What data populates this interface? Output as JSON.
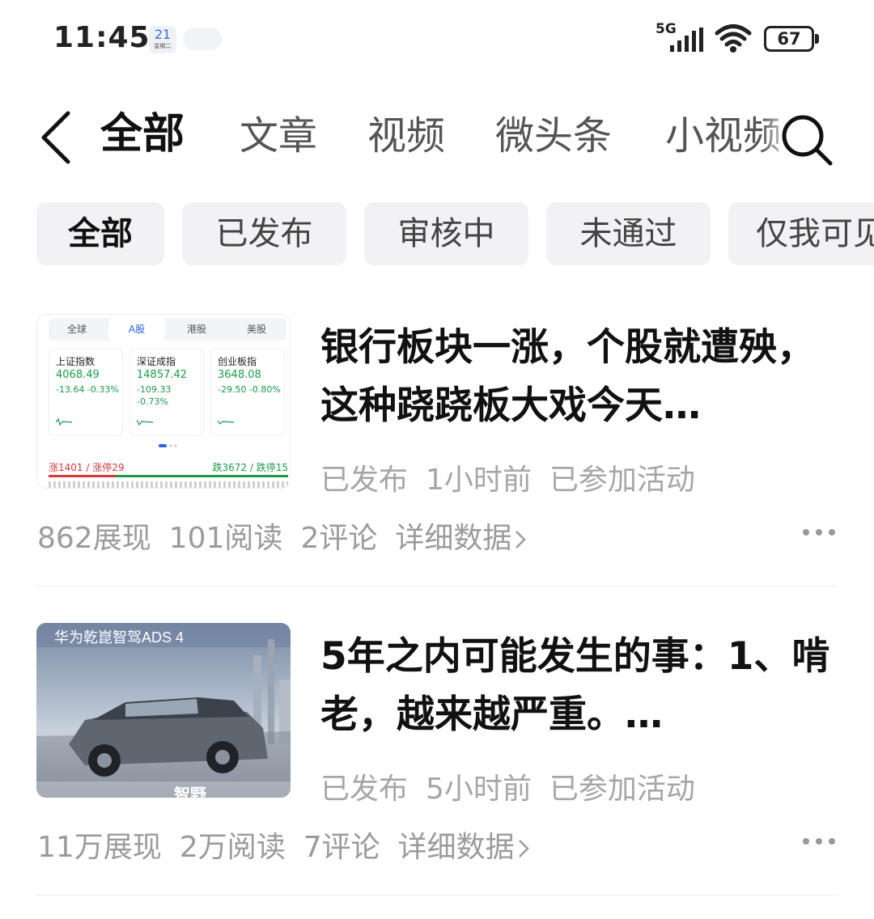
{
  "status_bar": {
    "time": "11:45",
    "calendar_day": "21",
    "calendar_sub": "星期二",
    "network": "5G",
    "battery": "67"
  },
  "header": {
    "tabs": [
      {
        "label": "全部",
        "active": true
      },
      {
        "label": "文章",
        "active": false
      },
      {
        "label": "视频",
        "active": false
      },
      {
        "label": "微头条",
        "active": false
      },
      {
        "label": "小视频",
        "active": false
      }
    ]
  },
  "filters": [
    {
      "label": "全部",
      "active": true
    },
    {
      "label": "已发布",
      "active": false
    },
    {
      "label": "审核中",
      "active": false
    },
    {
      "label": "未通过",
      "active": false
    },
    {
      "label": "仅我可见",
      "active": false
    }
  ],
  "feed": [
    {
      "title": "银行板块一涨，个股就遭殃，这种跷跷板大戏今天…",
      "meta": [
        "已发布",
        "1小时前",
        "已参加活动"
      ],
      "stats": [
        "862展现",
        "101阅读",
        "2评论"
      ],
      "detail_label": "详细数据",
      "thumbnail": {
        "tabs": [
          "全球",
          "A股",
          "港股",
          "美股"
        ],
        "selected_tab": "A股",
        "indices": [
          {
            "name": "上证指数",
            "value": "4068.49",
            "change": "-13.64 -0.33%"
          },
          {
            "name": "深证成指",
            "value": "14857.42",
            "change": "-109.33 -0.73%"
          },
          {
            "name": "创业板指",
            "value": "3648.08",
            "change": "-29.50 -0.80%"
          }
        ],
        "up_summary": "涨1401 / 涨停29",
        "down_summary": "跌3672 / 跌停15",
        "up_color": "#d9363e",
        "down_color": "#1a9b4b"
      }
    },
    {
      "title": "5年之内可能发生的事：1、啃老，越来越严重。…",
      "meta": [
        "已发布",
        "5小时前",
        "已参加活动"
      ],
      "stats": [
        "11万展现",
        "2万阅读",
        "7评论"
      ],
      "detail_label": "详细数据",
      "thumbnail": {
        "caption": "华为乾崑智驾ADS 4",
        "brand": "智野"
      }
    }
  ]
}
